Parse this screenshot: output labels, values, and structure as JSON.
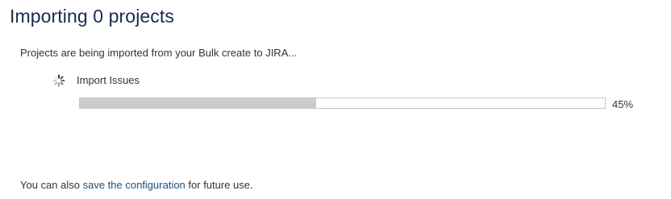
{
  "page": {
    "title": "Importing 0 projects",
    "status_message": "Projects are being imported from your Bulk create to JIRA..."
  },
  "task": {
    "label": "Import Issues",
    "spinner_icon": "loading-spinner-icon",
    "progress": 0.45,
    "progress_text": "45%"
  },
  "footer": {
    "prefix": "You can also ",
    "link_text": "save the configuration",
    "suffix": " for future use."
  },
  "colors": {
    "title": "#172b4d",
    "link": "#205081",
    "progress_fill": "#cccccc",
    "progress_border": "#c1c7d0"
  }
}
